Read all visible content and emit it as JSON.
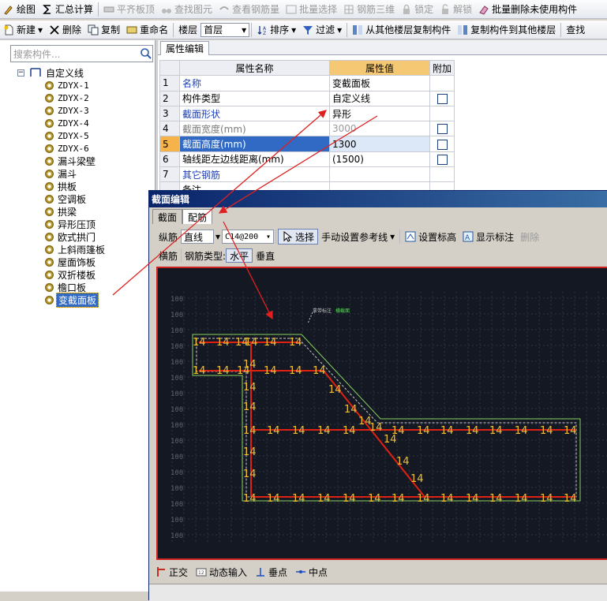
{
  "toolbar1": {
    "draw": "绘图",
    "sum": "汇总计算",
    "align_slab": "平齐板顶",
    "find_element": "查找图元",
    "view_rebar_qty": "查看钢筋量",
    "batch_select": "批量选择",
    "rebar_3d": "钢筋三维",
    "lock": "锁定",
    "unlock": "解锁",
    "batch_delete": "批量删除未使用构件"
  },
  "toolbar2": {
    "new": "新建",
    "delete": "删除",
    "copy": "复制",
    "rename": "重命名",
    "floor_label": "楼层",
    "floor_value": "首层",
    "sort": "排序",
    "filter": "过滤",
    "copy_from_floor": "从其他楼层复制构件",
    "copy_to_floor": "复制构件到其他楼层",
    "find": "查找"
  },
  "search": {
    "placeholder": "搜索构件..."
  },
  "tree": {
    "root": "自定义线",
    "items": [
      "ZDYX-1",
      "ZDYX-2",
      "ZDYX-3",
      "ZDYX-4",
      "ZDYX-5",
      "ZDYX-6",
      "漏斗梁壁",
      "漏斗",
      "拱板",
      "空调板",
      "拱梁",
      "异形压顶",
      "欧式拱门",
      "上斜雨篷板",
      "屋面饰板",
      "双折楼板",
      "檐口板",
      "变截面板"
    ],
    "selected": "变截面板"
  },
  "props": {
    "tab": "属性编辑",
    "col_name": "属性名称",
    "col_value": "属性值",
    "col_extra": "附加",
    "rows": [
      {
        "no": "1",
        "name": "名称",
        "value": ""
      },
      {
        "no": "2",
        "name": "构件类型",
        "value": "变截面板"
      },
      {
        "no": "3",
        "name": "截面形状",
        "value": "自定义线"
      },
      {
        "no": "4",
        "name": "截面宽度(mm)",
        "value": "异形"
      },
      {
        "no": "5",
        "name": "截面高度(mm)",
        "value": "3000"
      },
      {
        "no": "6",
        "name": "轴线距左边线距离(mm)",
        "value": "1300"
      },
      {
        "no": "7",
        "name": "其它钢筋",
        "value": "(1500)"
      },
      {
        "no": "",
        "name": "备注",
        "value": ""
      }
    ]
  },
  "dialog": {
    "title": "截面编辑",
    "tab_section": "截面",
    "tab_rebar": "配筋",
    "longitudinal": "纵筋",
    "line_mode": "直线",
    "rebar_spec": "C14@200",
    "select": "选择",
    "manual_ref": "手动设置参考线",
    "set_elev": "设置标高",
    "show_annot": "显示标注",
    "remove": "删除",
    "transverse": "横筋",
    "rebar_type_label": "钢筋类型:",
    "horizontal": "水平",
    "vertical": "垂直",
    "ortho": "正交",
    "dynamic_input": "动态输入",
    "perp_point": "垂点",
    "mid_point": "中点",
    "canvas_note_a": "拿带标注",
    "canvas_note_b": "横截面",
    "rebar_label": "14",
    "row_label": "100"
  }
}
